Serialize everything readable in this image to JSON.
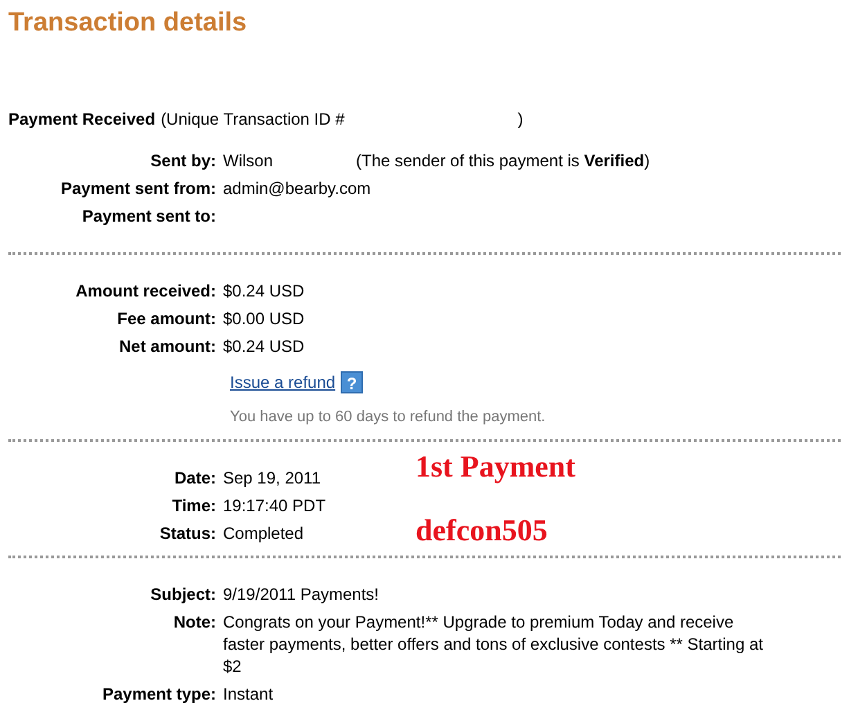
{
  "title": "Transaction details",
  "header": {
    "label": "Payment Received",
    "id_prefix": "(Unique Transaction ID #",
    "id_suffix": ")"
  },
  "sections": [
    {
      "rows": [
        {
          "label": "Sent by:",
          "value": "Wilson",
          "note": "(The sender of this payment is **Verified**)"
        },
        {
          "label": "Payment sent from:",
          "value": "admin@bearby.com"
        },
        {
          "label": "Payment sent to:"
        }
      ]
    },
    {
      "rows": [
        {
          "label": "Amount received:",
          "value": "$0.24 USD"
        },
        {
          "label": "Fee amount:",
          "value": "$0.00 USD"
        },
        {
          "label": "Net amount:",
          "value": "$0.24 USD"
        }
      ],
      "refund_link": "Issue a refund",
      "help_icon": "?",
      "refund_hint": "You have up to 60 days to refund the payment."
    },
    {
      "rows": [
        {
          "label": "Date:",
          "value": "Sep 19, 2011"
        },
        {
          "label": "Time:",
          "value": "19:17:40 PDT"
        },
        {
          "label": "Status:",
          "value": "Completed"
        }
      ],
      "annotations": [
        "1st Payment",
        "defcon505"
      ]
    },
    {
      "rows": [
        {
          "label": "Subject:",
          "value": "9/19/2011 Payments!"
        },
        {
          "label": "Note:",
          "value": "Congrats on your Payment!** Upgrade to premium Today and receive faster payments, better offers and tons of exclusive contests ** Starting at $2"
        },
        {
          "label": "Payment type:",
          "value": "Instant"
        }
      ]
    }
  ]
}
